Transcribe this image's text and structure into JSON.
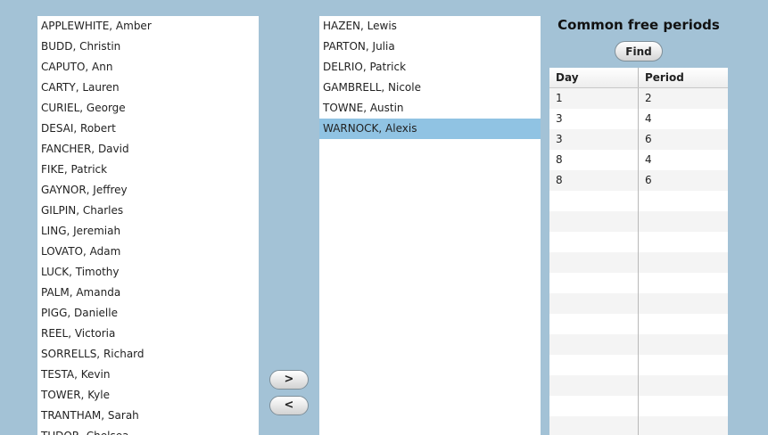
{
  "available_students": [
    "APPLEWHITE, Amber",
    "BUDD, Christin",
    "CAPUTO, Ann",
    "CARTY, Lauren",
    "CURIEL, George",
    "DESAI, Robert",
    "FANCHER, David",
    "FIKE, Patrick",
    "GAYNOR, Jeffrey",
    "GILPIN, Charles",
    "LING, Jeremiah",
    "LOVATO, Adam",
    "LUCK, Timothy",
    "PALM, Amanda",
    "PIGG, Danielle",
    "REEL, Victoria",
    "SORRELLS, Richard",
    "TESTA, Kevin",
    "TOWER, Kyle",
    "TRANTHAM, Sarah",
    "TUDOR, Chelsea"
  ],
  "selected_students": [
    "HAZEN, Lewis",
    "PARTON, Julia",
    "DELRIO, Patrick",
    "GAMBRELL, Nicole",
    "TOWNE, Austin",
    "WARNOCK, Alexis"
  ],
  "highlighted_selected": "WARNOCK, Alexis",
  "buttons": {
    "add": ">",
    "remove": "<",
    "find": "Find"
  },
  "free_periods": {
    "title": "Common free periods",
    "columns": [
      "Day",
      "Period"
    ],
    "rows": [
      [
        "1",
        "2"
      ],
      [
        "3",
        "4"
      ],
      [
        "3",
        "6"
      ],
      [
        "8",
        "4"
      ],
      [
        "8",
        "6"
      ]
    ],
    "total_visible_rows": 17
  },
  "colors": {
    "background": "#a3c2d6",
    "selection": "#90c3e3"
  }
}
